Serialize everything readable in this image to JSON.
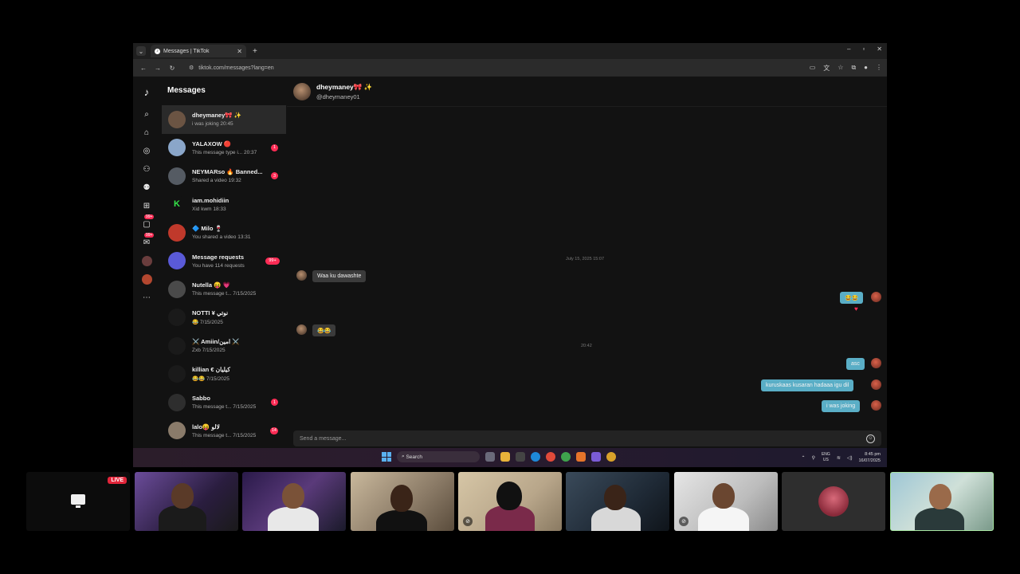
{
  "browser": {
    "tab_title": "Messages | TikTok",
    "tab_icon": "tiktok-icon",
    "new_tab": "+",
    "url": "tiktok.com/messages?lang=en",
    "window_controls": [
      "–",
      "▫",
      "✕"
    ]
  },
  "sidebar": {
    "title": "Messages",
    "rail_badges": [
      "99+",
      "99+"
    ]
  },
  "conversations": [
    {
      "name": "dheymaney🎀 ✨",
      "preview": "i was joking 20:45",
      "unread": "",
      "avatar_color": "#6b5443",
      "active": true
    },
    {
      "name": "YALAXOW 🔴",
      "preview": "This message type i... 20:37",
      "unread": "1",
      "avatar_color": "#8aa6c9"
    },
    {
      "name": "NEYMARso 🔥 Banned...",
      "preview": "Shared a video 19:32",
      "unread": "3",
      "avatar_color": "#555b63"
    },
    {
      "name": "iam.mohidiin",
      "preview": "Xid kwm 18:33",
      "unread": "",
      "avatar_color": "#121212",
      "avatar_letter": "K"
    },
    {
      "name": "🔷 Milo 🍷",
      "preview": "You shared a video 13:31",
      "unread": "",
      "avatar_color": "#c0392b"
    },
    {
      "name": "Message requests",
      "preview": "You have 114 requests",
      "unread": "99+",
      "avatar_color": "#5a5ad8"
    },
    {
      "name": "Nutella 😝 💗",
      "preview": "This message t... 7/15/2025",
      "unread": "",
      "avatar_color": "#4a4a4a"
    },
    {
      "name": "NOTTI ¥ نوتي",
      "preview": "😂 7/15/2025",
      "unread": "",
      "avatar_color": "#1a1a1a"
    },
    {
      "name": "⚔️ Amiin/امين ⚔️",
      "preview": "Zxb 7/15/2025",
      "unread": "",
      "avatar_color": "#1a1a1a"
    },
    {
      "name": "killian € كيليان",
      "preview": "😂😂 7/15/2025",
      "unread": "",
      "avatar_color": "#1a1a1a"
    },
    {
      "name": "Sabbo",
      "preview": "This message t... 7/15/2025",
      "unread": "1",
      "avatar_color": "#2e2e2e"
    },
    {
      "name": "lalo😝 لالو",
      "preview": "This message t... 7/15/2025",
      "unread": "14",
      "avatar_color": "#8a7b6a"
    }
  ],
  "chat": {
    "name": "dheymaney🎀 ✨",
    "handle": "@dheymaney01",
    "date_stamp": "July 15, 2025 15:07",
    "time_stamp": "20:42",
    "messages": [
      {
        "from": "them",
        "text": "Waa ku dawashte"
      },
      {
        "from": "me",
        "text": "😂😂"
      },
      {
        "from": "them",
        "text": "😂😂"
      },
      {
        "from": "me",
        "text": "asc"
      },
      {
        "from": "me",
        "text": "kuruskaas kusaran hadaaa igu dil"
      },
      {
        "from": "me",
        "text": "i was joking"
      }
    ],
    "reaction": "♥",
    "composer_placeholder": "Send a message..."
  },
  "taskbar": {
    "search_label": "Search",
    "lang": "ENG",
    "region": "US",
    "time": "8:45 pm",
    "date": "16/07/2025"
  },
  "stream": {
    "live_label": "LIVE"
  },
  "colors": {
    "tiktok_pink": "#fe2c55",
    "outgoing_bubble": "#5aaec6",
    "incoming_bubble": "#3b3b3b",
    "selected_tile_border": "#a8e6a3"
  }
}
